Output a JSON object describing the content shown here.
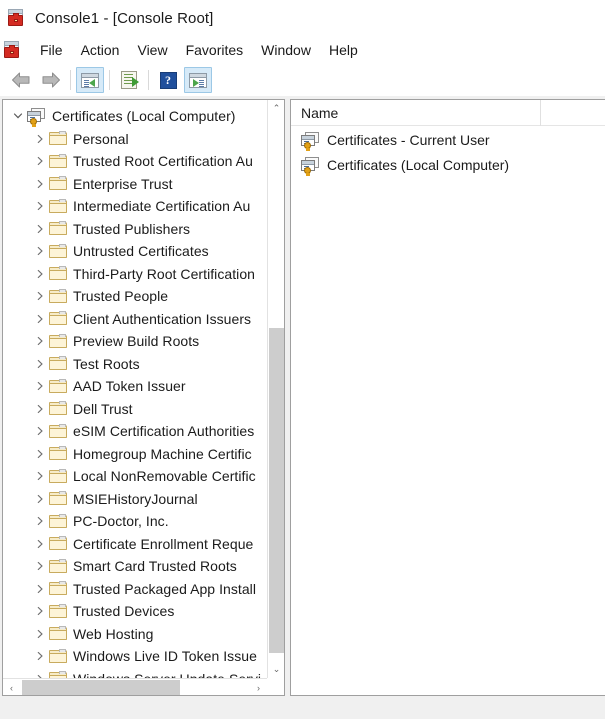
{
  "window": {
    "title": "Console1 - [Console Root]",
    "icon": "mmc-console-icon"
  },
  "menubar": {
    "icon": "mmc-console-icon",
    "items": [
      {
        "label": "File"
      },
      {
        "label": "Action"
      },
      {
        "label": "View"
      },
      {
        "label": "Favorites"
      },
      {
        "label": "Window"
      },
      {
        "label": "Help"
      }
    ]
  },
  "toolbar": {
    "buttons": [
      {
        "name": "back-button",
        "icon": "back-arrow-icon",
        "selected": false
      },
      {
        "name": "forward-button",
        "icon": "forward-arrow-icon",
        "selected": false
      },
      {
        "name": "show-hide-tree-button",
        "icon": "console-tree-icon",
        "selected": true
      },
      {
        "name": "export-list-button",
        "icon": "export-list-icon",
        "selected": false
      },
      {
        "name": "help-button",
        "icon": "help-question-icon",
        "selected": false
      },
      {
        "name": "show-action-pane-button",
        "icon": "action-pane-icon",
        "selected": true
      }
    ]
  },
  "tree": {
    "root": {
      "label": "Certificates (Local Computer)",
      "icon": "certificate-store-icon",
      "expanded": true
    },
    "children": [
      {
        "label": "Personal",
        "icon": "folder-icon",
        "expanded": false
      },
      {
        "label": "Trusted Root Certification Au",
        "icon": "folder-icon",
        "expanded": false
      },
      {
        "label": "Enterprise Trust",
        "icon": "folder-icon",
        "expanded": false
      },
      {
        "label": "Intermediate Certification Au",
        "icon": "folder-icon",
        "expanded": false
      },
      {
        "label": "Trusted Publishers",
        "icon": "folder-icon",
        "expanded": false
      },
      {
        "label": "Untrusted Certificates",
        "icon": "folder-icon",
        "expanded": false
      },
      {
        "label": "Third-Party Root Certification",
        "icon": "folder-icon",
        "expanded": false
      },
      {
        "label": "Trusted People",
        "icon": "folder-icon",
        "expanded": false
      },
      {
        "label": "Client Authentication Issuers",
        "icon": "folder-icon",
        "expanded": false
      },
      {
        "label": "Preview Build Roots",
        "icon": "folder-icon",
        "expanded": false
      },
      {
        "label": "Test Roots",
        "icon": "folder-icon",
        "expanded": false
      },
      {
        "label": "AAD Token Issuer",
        "icon": "folder-icon",
        "expanded": false
      },
      {
        "label": "Dell Trust",
        "icon": "folder-icon",
        "expanded": false
      },
      {
        "label": "eSIM Certification Authorities",
        "icon": "folder-icon",
        "expanded": false
      },
      {
        "label": "Homegroup Machine Certific",
        "icon": "folder-icon",
        "expanded": false
      },
      {
        "label": "Local NonRemovable Certific",
        "icon": "folder-icon",
        "expanded": false
      },
      {
        "label": "MSIEHistoryJournal",
        "icon": "folder-icon",
        "expanded": false
      },
      {
        "label": "PC-Doctor, Inc.",
        "icon": "folder-icon",
        "expanded": false
      },
      {
        "label": "Certificate Enrollment Reque",
        "icon": "folder-icon",
        "expanded": false
      },
      {
        "label": "Smart Card Trusted Roots",
        "icon": "folder-icon",
        "expanded": false
      },
      {
        "label": "Trusted Packaged App Install",
        "icon": "folder-icon",
        "expanded": false
      },
      {
        "label": "Trusted Devices",
        "icon": "folder-icon",
        "expanded": false
      },
      {
        "label": "Web Hosting",
        "icon": "folder-icon",
        "expanded": false
      },
      {
        "label": "Windows Live ID Token Issue",
        "icon": "folder-icon",
        "expanded": false
      },
      {
        "label": "Windows Server Update Servi",
        "icon": "folder-icon",
        "expanded": false
      }
    ],
    "vertical_scrollbar": {
      "up_glyph": "⌃",
      "down_glyph": "⌄"
    },
    "horizontal_scrollbar": {
      "left_glyph": "‹",
      "right_glyph": "›"
    }
  },
  "list": {
    "columns": [
      {
        "label": "Name"
      }
    ],
    "rows": [
      {
        "name": "Certificates - Current User",
        "icon": "certificate-store-icon"
      },
      {
        "name": "Certificates (Local Computer)",
        "icon": "certificate-store-icon"
      }
    ]
  },
  "colors": {
    "accent_selected_toolbar": "#d6eaf8",
    "folder_fill": "#fdf4d8",
    "scrollbar_thumb": "#cdcdcd",
    "text": "#1b1b1b",
    "pane_border": "#9f9f9f"
  }
}
